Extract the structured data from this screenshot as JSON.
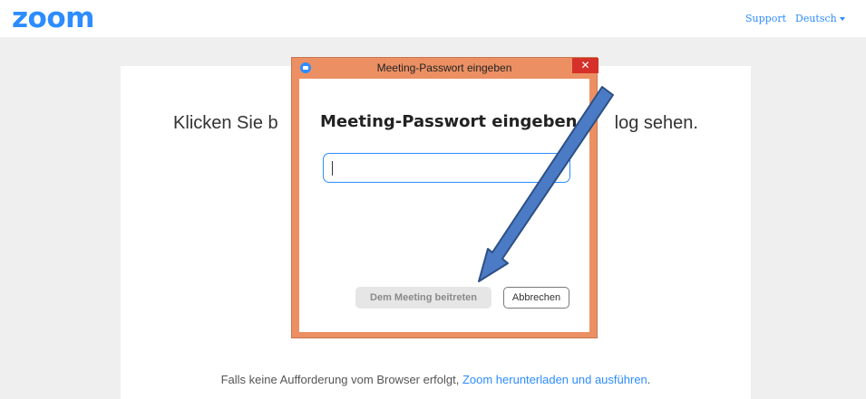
{
  "header": {
    "logo_text": "zoom",
    "support_link": "Support",
    "language_selector": "Deutsch"
  },
  "card": {
    "headline_left": "Klicken Sie b",
    "headline_right": "log sehen.",
    "footer_text": "Falls keine Aufforderung vom Browser erfolgt, ",
    "footer_link": "Zoom herunterladen und ausführen",
    "footer_end": "."
  },
  "dialog": {
    "window_title": "Meeting-Passwort eingeben",
    "close_label": "✕",
    "heading": "Meeting-Passwort eingeben",
    "password_value": "",
    "join_button": "Dem Meeting beitreten",
    "cancel_button": "Abbrechen"
  },
  "colors": {
    "brand": "#2d8cff",
    "dialog_frame": "#ec9064",
    "close_button": "#d5312a",
    "annotation_arrow": "#3c6bb5"
  },
  "icons": {
    "app_icon": "zoom-camera-icon",
    "close_icon": "close-icon",
    "caret_icon": "caret-down-icon",
    "annotation": "arrow-annotation-icon"
  }
}
